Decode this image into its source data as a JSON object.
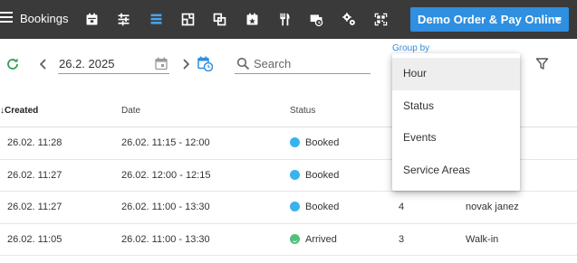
{
  "app": {
    "title": "Bookings"
  },
  "nav": {
    "icons": [
      "calendar-icon",
      "sliders-icon",
      "list-icon",
      "floorplan-icon",
      "copy-icon",
      "calendar-star-icon",
      "cutlery-icon",
      "truck-clock-icon",
      "gears-icon",
      "qr-code-icon"
    ],
    "active": "list-icon"
  },
  "demo_button": {
    "label": "Demo Order & Pay Online"
  },
  "toolbar": {
    "date_value": "26.2. 2025",
    "search_placeholder": "Search",
    "group_by_label": "Group by"
  },
  "table": {
    "columns": {
      "created": "Created",
      "date": "Date",
      "status": "Status"
    },
    "rows": [
      {
        "created": "26.02. 11:28",
        "date": "26.02. 11:15 - 12:00",
        "status": "Booked",
        "guests": "",
        "name": ""
      },
      {
        "created": "26.02. 11:27",
        "date": "26.02. 12:00 - 12:15",
        "status": "Booked",
        "guests": "",
        "name": ""
      },
      {
        "created": "26.02. 11:27",
        "date": "26.02. 11:00 - 13:30",
        "status": "Booked",
        "guests": "4",
        "name": "novak janez"
      },
      {
        "created": "26.02. 11:05",
        "date": "26.02. 11:00 - 13:30",
        "status": "Arrived",
        "guests": "3",
        "name": "Walk-in"
      }
    ]
  },
  "group_by_menu": {
    "options": [
      "Hour",
      "Status",
      "Events",
      "Service Areas"
    ],
    "selected": "Hour"
  },
  "colors": {
    "topbar": "#3a3a3a",
    "accent": "#2f8fe0",
    "booked": "#39b3f0",
    "arrived": "#52c07a",
    "refresh": "#2e9e4f"
  }
}
